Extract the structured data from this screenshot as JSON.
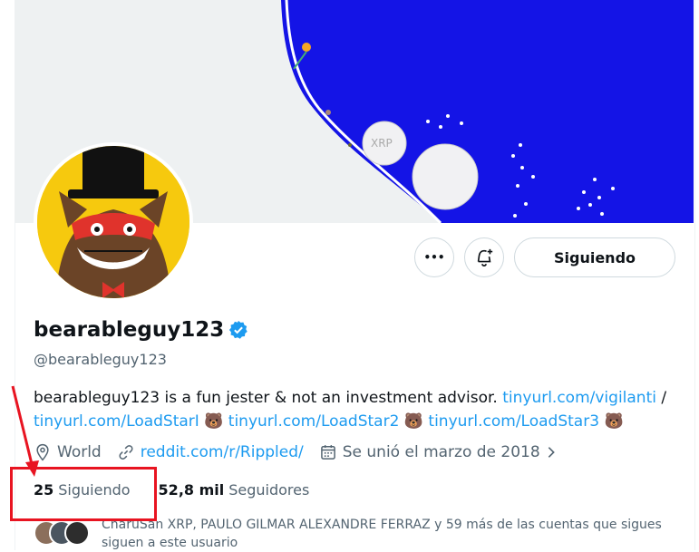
{
  "profile": {
    "display_name": "bearableguy123",
    "handle": "@bearableguy123",
    "bio_text": "bearableguy123 is a fun jester & not an investment advisor. ",
    "bio_links": [
      "tinyurl.com/vigilanti",
      "tinyurl.com/LoadStarI",
      "tinyurl.com/LoadStar2",
      "tinyurl.com/LoadStar3"
    ],
    "bio_separator": " /",
    "bear_emoji": "🐻",
    "location": "World",
    "website": "reddit.com/r/Rippled/",
    "joined": "Se unió el marzo de 2018",
    "verified_badge_color": "#1d9bf0"
  },
  "actions": {
    "more_label": "•••",
    "follow_label": "Siguiendo"
  },
  "stats": {
    "following_count": "25",
    "following_label": "Siguiendo",
    "followers_count": "52,8 mil",
    "followers_label": "Seguidores"
  },
  "followers_you_know": "CharuSan XRP, PAULO GILMAR ALEXANDRE FERRAZ y 59 más de las cuentas que sigues siguen a este usuario",
  "annotation": {
    "color": "#e81421"
  }
}
